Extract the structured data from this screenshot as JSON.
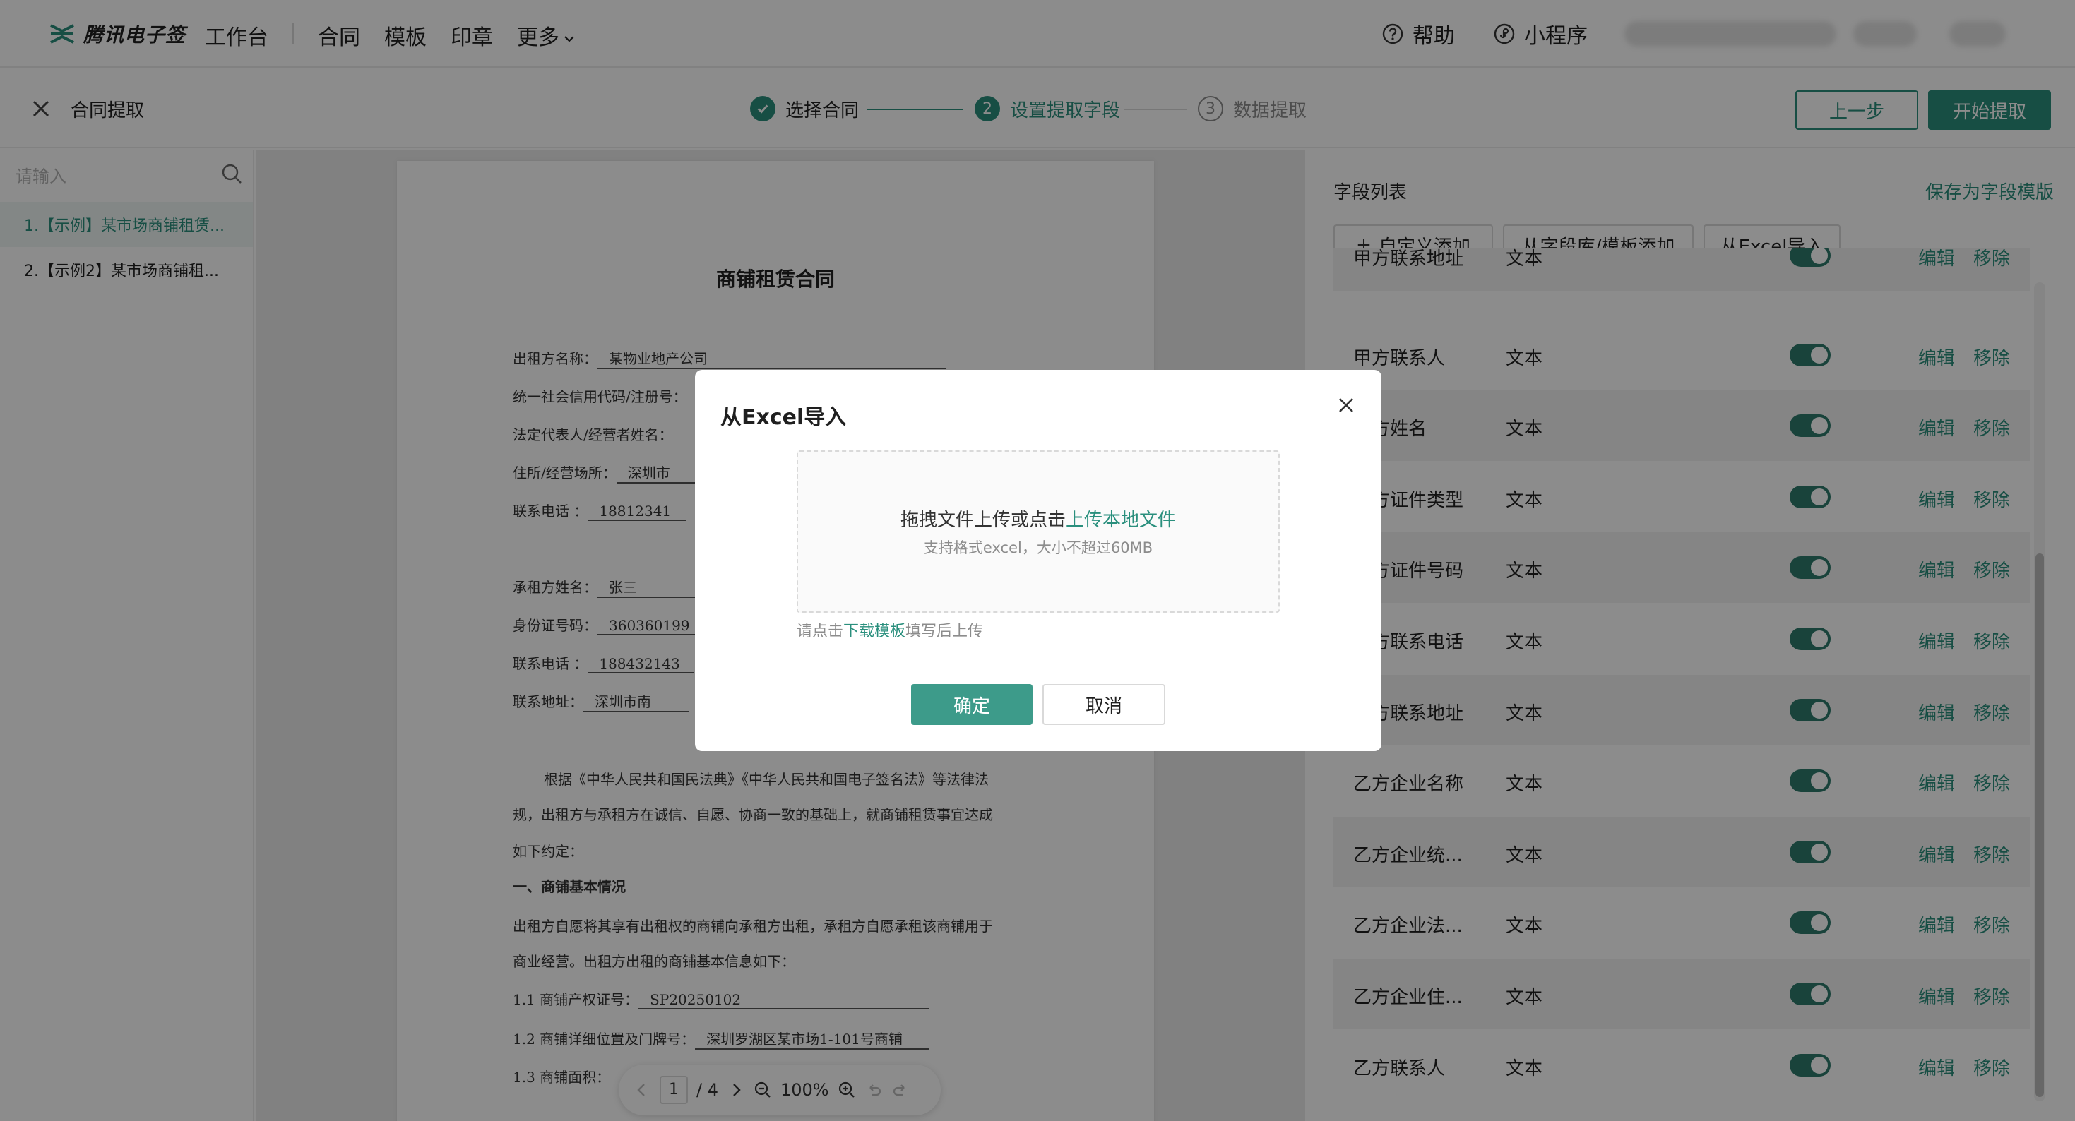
{
  "nav": {
    "brand": "腾讯电子签",
    "workspace": "工作台",
    "contract": "合同",
    "template": "模板",
    "seal": "印章",
    "more": "更多",
    "help": "帮助",
    "miniprogram": "小程序"
  },
  "header": {
    "title": "合同提取",
    "steps": [
      {
        "num": "1",
        "label": "选择合同",
        "state": "done"
      },
      {
        "num": "2",
        "label": "设置提取字段",
        "state": "active"
      },
      {
        "num": "3",
        "label": "数据提取",
        "state": "pending"
      }
    ],
    "prev_label": "上一步",
    "start_label": "开始提取"
  },
  "sidebar": {
    "search_placeholder": "请输入",
    "items": [
      {
        "label": "1.【示例】某市场商铺租赁...",
        "active": true
      },
      {
        "label": "2.【示例2】某市场商铺租...",
        "active": false
      }
    ]
  },
  "document": {
    "title": "商铺租赁合同",
    "lessor_name_label": "出租方名称：",
    "lessor_name_value": "某物业地产公司",
    "credit_code_label": "统一社会信用代码/注册号：",
    "legal_rep_label": "法定代表人/经营者姓名：",
    "address_label": "住所/经营场所：",
    "address_value": "深圳市",
    "phone_label": "联系电话 ：",
    "phone_value": "18812341",
    "lessee_name_label": "承租方姓名：",
    "lessee_name_value": "张三",
    "id_label": "身份证号码：",
    "id_value": "360360199",
    "lessee_phone_label": "联系电话 ：",
    "lessee_phone_value": "188432143",
    "lessee_addr_label": "联系地址：",
    "lessee_addr_value": "深圳市南",
    "para1": "根据《中华人民共和国民法典》《中华人民共和国电子签名法》等法律法",
    "para2": "规，出租方与承租方在诚信、自愿、协商一致的基础上，就商铺租赁事宜达成",
    "para3": "如下约定：",
    "section1": "一、商铺基本情况",
    "para4": "出租方自愿将其享有出租权的商铺向承租方出租，承租方自愿承租该商铺用于",
    "para5": "商业经营。出租方出租的商铺基本信息如下：",
    "item11_label": "1.1 商铺产权证号：",
    "item11_value": "SP20250102",
    "item12_label": "1.2 商铺详细位置及门牌号：",
    "item12_value": "深圳罗湖区某市场1-101号商铺",
    "item13_label": "1.3 商铺面积：",
    "pager": {
      "current": "1",
      "total": "/ 4",
      "zoom": "100%"
    }
  },
  "fields_panel": {
    "title": "字段列表",
    "save_template": "保存为字段模版",
    "btn_custom": "自定义添加",
    "btn_library": "从字段库/模板添加",
    "btn_excel": "从Excel导入",
    "edit_label": "编辑",
    "remove_label": "移除",
    "rows": [
      {
        "name": "甲方联系地址",
        "type": "文本"
      },
      {
        "name": "甲方联系人",
        "type": "文本"
      },
      {
        "name": "乙方姓名",
        "type": "文本"
      },
      {
        "name": "乙方证件类型",
        "type": "文本"
      },
      {
        "name": "乙方证件号码",
        "type": "文本"
      },
      {
        "name": "乙方联系电话",
        "type": "文本"
      },
      {
        "name": "乙方联系地址",
        "type": "文本"
      },
      {
        "name": "乙方企业名称",
        "type": "文本"
      },
      {
        "name": "乙方企业统...",
        "type": "文本"
      },
      {
        "name": "乙方企业法...",
        "type": "文本"
      },
      {
        "name": "乙方企业住...",
        "type": "文本"
      },
      {
        "name": "乙方联系人",
        "type": "文本"
      }
    ]
  },
  "modal": {
    "title": "从Excel导入",
    "drop_text": "拖拽文件上传或点击",
    "drop_link": "上传本地文件",
    "drop_sub": "支持格式excel，大小不超过60MB",
    "hint_prefix": "请点击",
    "hint_link": "下载模板",
    "hint_suffix": "填写后上传",
    "ok_label": "确定",
    "cancel_label": "取消"
  },
  "colors": {
    "accent": "#2a8f7d",
    "toggle": "#2f7a6c",
    "primary_btn": "#3d9b8a"
  }
}
